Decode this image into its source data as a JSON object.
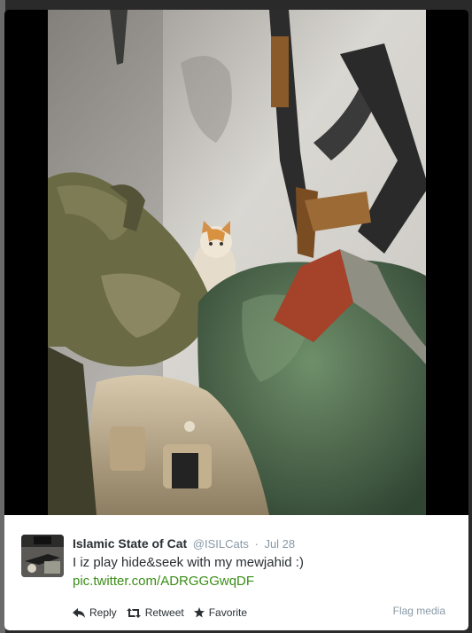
{
  "tweet": {
    "display_name": "Islamic State of Cat",
    "handle": "@ISILCats",
    "separator": "·",
    "date": "Jul 28",
    "text": "I iz play hide&seek with my mewjahid :)",
    "link_text": "pic.twitter.com/ADRGGGwqDF"
  },
  "actions": {
    "reply_label": "Reply",
    "retweet_label": "Retweet",
    "favorite_label": "Favorite",
    "flag_label": "Flag media"
  },
  "icons": {
    "reply": "reply-icon",
    "retweet": "retweet-icon",
    "favorite": "star-icon"
  },
  "colors": {
    "link": "#3a8e16",
    "muted": "#8899a6",
    "text": "#292f33",
    "card_bg": "#ffffff",
    "lightbox_bg": "#000000"
  }
}
